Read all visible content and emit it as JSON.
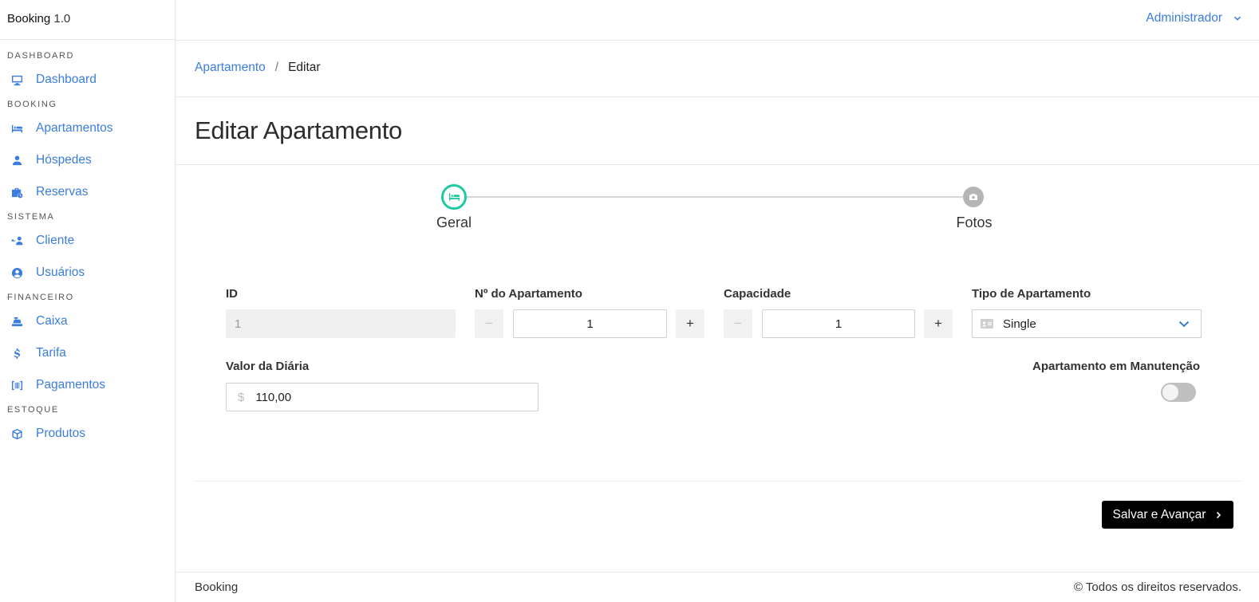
{
  "brand": {
    "name": "Booking",
    "version": "1.0"
  },
  "sidebar": {
    "sections": [
      {
        "title": "DASHBOARD",
        "items": [
          {
            "label": "Dashboard",
            "icon": "monitor-icon"
          }
        ]
      },
      {
        "title": "BOOKING",
        "items": [
          {
            "label": "Apartamentos",
            "icon": "bed-icon"
          },
          {
            "label": "Hóspedes",
            "icon": "user-icon"
          },
          {
            "label": "Reservas",
            "icon": "briefcase-clock-icon"
          }
        ]
      },
      {
        "title": "SISTEMA",
        "items": [
          {
            "label": "Cliente",
            "icon": "user-network-icon"
          },
          {
            "label": "Usuários",
            "icon": "user-circle-icon"
          }
        ]
      },
      {
        "title": "FINANCEIRO",
        "items": [
          {
            "label": "Caixa",
            "icon": "cash-register-icon"
          },
          {
            "label": "Tarifa",
            "icon": "dollar-icon"
          },
          {
            "label": "Pagamentos",
            "icon": "barcode-icon"
          }
        ]
      },
      {
        "title": "ESTOQUE",
        "items": [
          {
            "label": "Produtos",
            "icon": "box-icon"
          }
        ]
      }
    ]
  },
  "header": {
    "user": "Administrador"
  },
  "breadcrumb": {
    "parent": "Apartamento",
    "separator": "/",
    "current": "Editar"
  },
  "page": {
    "title": "Editar Apartamento"
  },
  "stepper": {
    "steps": [
      {
        "label": "Geral",
        "icon": "bed-icon",
        "active": true
      },
      {
        "label": "Fotos",
        "icon": "camera-icon",
        "active": false
      }
    ]
  },
  "form": {
    "id": {
      "label": "ID",
      "value": "1"
    },
    "numero": {
      "label": "Nº do Apartamento",
      "value": "1",
      "minus": "−",
      "plus": "+"
    },
    "capacidade": {
      "label": "Capacidade",
      "value": "1",
      "minus": "−",
      "plus": "+"
    },
    "tipo": {
      "label": "Tipo de Apartamento",
      "value": "Single"
    },
    "valor": {
      "label": "Valor da Diária",
      "prefix": "$",
      "value": "110,00"
    },
    "manutencao": {
      "label": "Apartamento em Manutenção",
      "checked": false
    }
  },
  "actions": {
    "submit": "Salvar e Avançar"
  },
  "footer": {
    "left": "Booking",
    "right": "© Todos os direitos reservados."
  },
  "colors": {
    "accent": "#3b7ddd",
    "step_active": "#1ec9a4",
    "submit_bg": "#000000"
  }
}
